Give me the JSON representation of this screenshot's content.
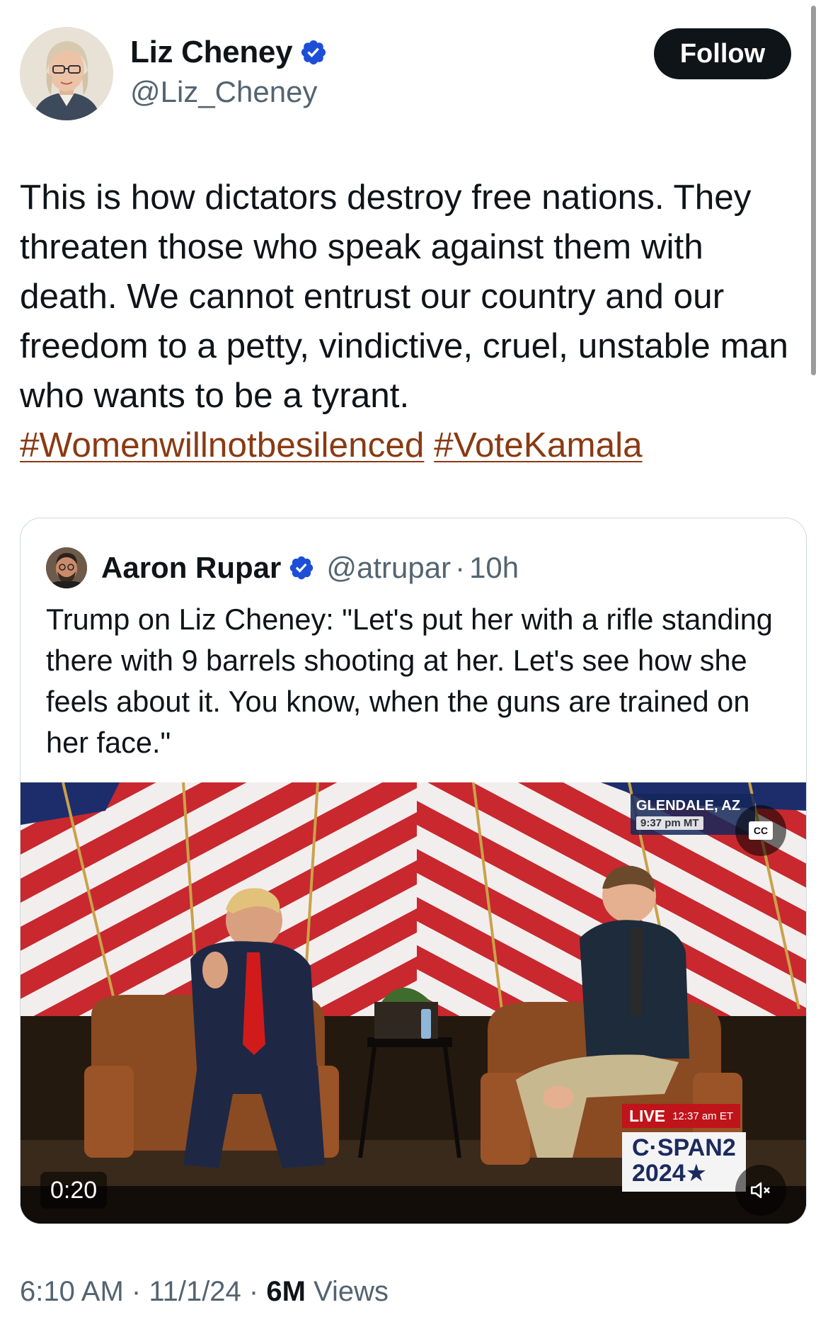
{
  "author": {
    "name": "Liz Cheney",
    "handle": "@Liz_Cheney",
    "verified": true,
    "follow_label": "Follow"
  },
  "tweet": {
    "text": "This is how dictators destroy free nations. They threaten those who speak against them with death. We cannot entrust our country and our freedom to a petty, vindictive, cruel, unstable man who wants to be a tyrant.",
    "hashtags": [
      "#Womenwillnotbesilenced",
      "#VoteKamala"
    ]
  },
  "quoted_tweet": {
    "name": "Aaron Rupar",
    "handle": "@atrupar",
    "separator": "·",
    "age": "10h",
    "verified": true,
    "text": "Trump on Liz Cheney: \"Let's put her with a rifle standing there with 9 barrels shooting at her. Let's see how she feels about it. You know, when the guns are trained on her face.\"",
    "video": {
      "duration": "0:20",
      "location": "GLENDALE, AZ",
      "local_time": "9:37 pm MT",
      "live_label": "LIVE",
      "live_time": "12:37 am ET",
      "network_line1": "C·SPAN2",
      "network_line2": "2024★",
      "cc_label": "CC",
      "mute_icon": "speaker-muted-icon"
    }
  },
  "footer": {
    "time": "6:10 AM",
    "sep1": " · ",
    "date": "11/1/24",
    "sep2": " · ",
    "views_count": "6M",
    "views_label": " Views"
  },
  "colors": {
    "hashtag": "#8a3a12",
    "verified": "#1d4ed8",
    "text": "#0f1419",
    "muted": "#536471",
    "follow_bg": "#0f1419"
  }
}
